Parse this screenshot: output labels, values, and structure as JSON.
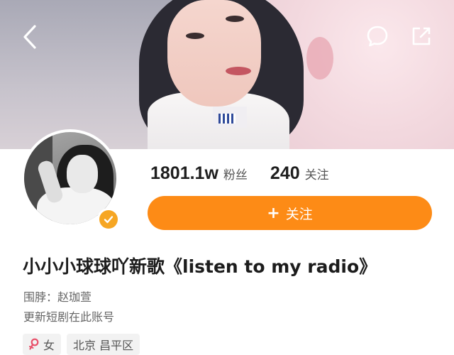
{
  "header": {
    "back_icon": "chevron-left-icon",
    "comment_icon": "comment-bubble-icon",
    "share_icon": "share-external-icon"
  },
  "profile": {
    "verified_badge": "verified-check-icon",
    "name": "小小小球球吖新歌《listen to my radio》",
    "bio_line1": "围脖：赵珈萱",
    "bio_line2": "更新短剧在此账号"
  },
  "stats": {
    "followers_count": "1801.1w",
    "followers_label": "粉丝",
    "following_count": "240",
    "following_label": "关注"
  },
  "follow_button": {
    "plus": "+",
    "label": "关注"
  },
  "tags": {
    "gender_icon": "female-symbol-icon",
    "gender": "女",
    "location": "北京 昌平区"
  },
  "colors": {
    "accent": "#fd8b16",
    "verified": "#f6a623",
    "female_icon": "#e8506a",
    "tag_bg": "#f2f2f2"
  }
}
